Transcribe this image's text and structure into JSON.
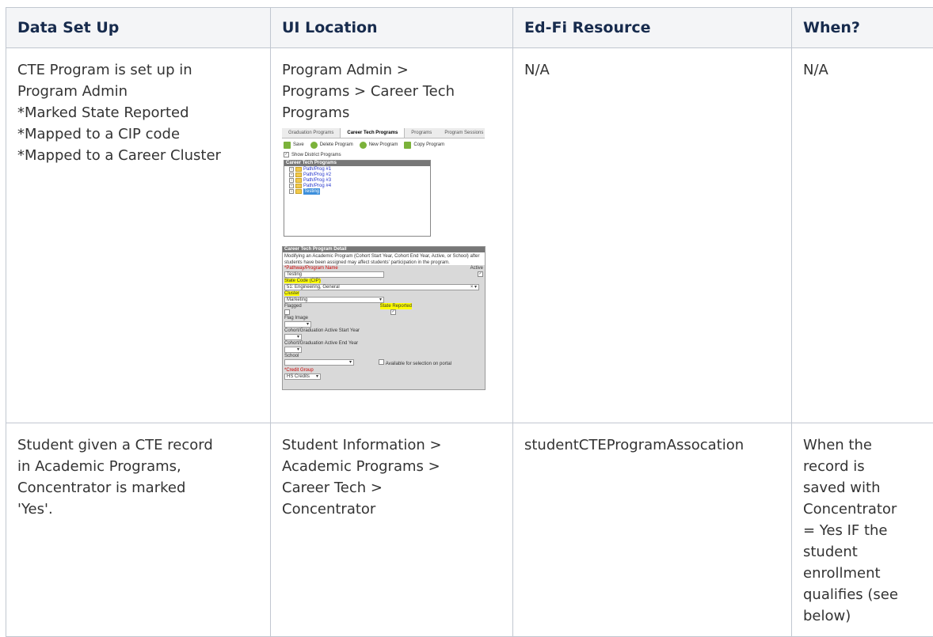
{
  "table": {
    "headers": [
      "Data Set Up",
      "UI Location",
      "Ed-Fi Resource",
      "When?"
    ],
    "rows": [
      {
        "data_set_up": [
          "CTE Program is set up in",
          "Program Admin",
          "*Marked State Reported",
          "*Mapped to a CIP code",
          "*Mapped to a Career Cluster"
        ],
        "ui_location": [
          "Program Admin >",
          "Programs > Career Tech",
          "Programs"
        ],
        "ed_fi_resource": "N/A",
        "when": "N/A"
      },
      {
        "data_set_up": [
          "Student given a CTE record",
          "in Academic Programs,",
          "Concentrator is marked",
          "'Yes'."
        ],
        "ui_location": [
          "Student Information >",
          "Academic Programs >",
          "Career Tech >",
          "Concentrator"
        ],
        "ed_fi_resource": "studentCTEProgramAssocation",
        "when": [
          "When the",
          "record is",
          "saved with",
          "Concentrator",
          "= Yes IF the",
          "student",
          "enrollment",
          "qualifies (see",
          "below)"
        ]
      }
    ]
  },
  "screenshot": {
    "tabs": [
      "Graduation Programs",
      "Career Tech Programs",
      "Programs",
      "Program Sessions"
    ],
    "active_tab": "Career Tech Programs",
    "toolbar": {
      "save": "Save",
      "delete": "Delete Program",
      "new": "New Program",
      "copy": "Copy Program"
    },
    "show_district": "Show District Programs",
    "tree_title": "Career Tech Programs",
    "tree_items": [
      "Path/Prog #1",
      "Path/Prog #2",
      "Path/Prog #3",
      "Path/Prog #4"
    ],
    "tree_selected": "Testing",
    "detail_title": "Career Tech Program Detail",
    "detail_note": "Modifying an Academic Program (Cohort Start Year, Cohort End Year, Active, or School) after students have been assigned may affect students' participation in the program.",
    "fields": {
      "name_label": "*Pathway/Program Name",
      "name_value": "Testing",
      "active_label": "Active",
      "state_code_label": "State Code (CIP)",
      "state_code_value": "51: Engineering, General",
      "cluster_label": "Cluster",
      "cluster_value": "Marketing",
      "flagged_label": "Flagged",
      "state_reported_label": "State Reported",
      "flag_image_label": "Flag Image",
      "start_year_label": "Cohort/Graduation Active Start Year",
      "end_year_label": "Cohort/Graduation Active End Year",
      "school_label": "School",
      "portal_label": "Available for selection on portal",
      "credit_group_label": "*Credit Group",
      "credit_group_value": "HS Credits"
    }
  }
}
